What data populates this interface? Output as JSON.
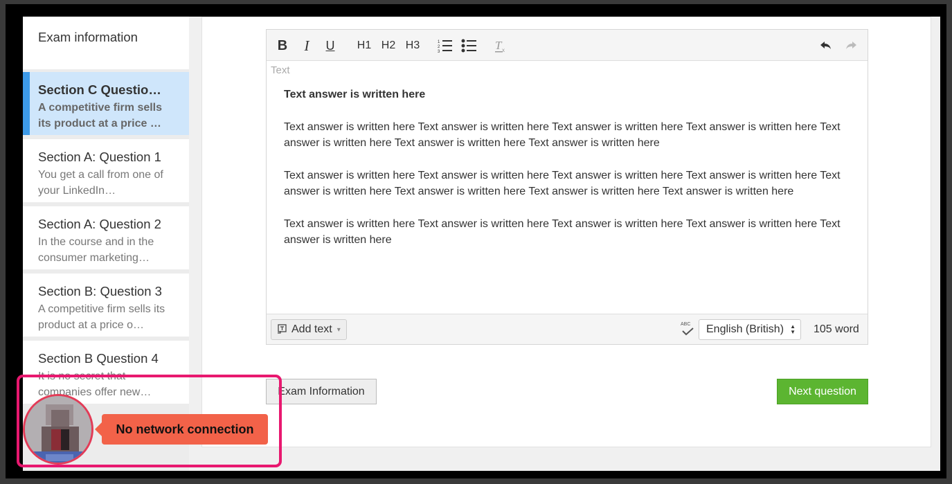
{
  "sidebar": {
    "exam_info_label": "Exam information",
    "items": [
      {
        "title": "Section C Questio…",
        "preview": "A competitive firm sells its product at a price …",
        "active": true
      },
      {
        "title": "Section A: Question 1",
        "preview": "You get a call from one of your LinkedIn…"
      },
      {
        "title": "Section A: Question 2",
        "preview": "In the course and in the consumer marketing…"
      },
      {
        "title": "Section B: Question 3",
        "preview": "A competitive firm sells its product at a price o…"
      },
      {
        "title": "Section B Question 4",
        "preview": "It is no secret that companies offer new…"
      }
    ]
  },
  "toolbar": {
    "bold": "B",
    "italic": "I",
    "underline": "U",
    "h1": "H1",
    "h2": "H2",
    "h3": "H3"
  },
  "editor": {
    "field_label": "Text",
    "paragraphs": [
      "Text answer is written here",
      "Text answer is written here Text answer is written here  Text answer is written here  Text answer is written here Text answer is written here Text answer is written here Text answer is written here",
      "Text answer is written here Text answer is written here Text answer is written here  Text answer is written here Text answer is written here Text answer is written here Text answer is written here Text answer is written here",
      "Text answer is written here Text answer is written here Text answer is written here Text answer is written here Text answer is written here"
    ],
    "add_text_label": "Add text",
    "spellcheck_label": "ABC",
    "language": "English (British)",
    "word_count": "105 word"
  },
  "buttons": {
    "exam_information": "Exam Information",
    "next_question": "Next question"
  },
  "network": {
    "message": "No network connection"
  },
  "colors": {
    "active_bg": "#cfe6fb",
    "active_border": "#3d9ae8",
    "next_button": "#5cb531",
    "alert_bg": "#f26249",
    "outline": "#e8186f"
  }
}
